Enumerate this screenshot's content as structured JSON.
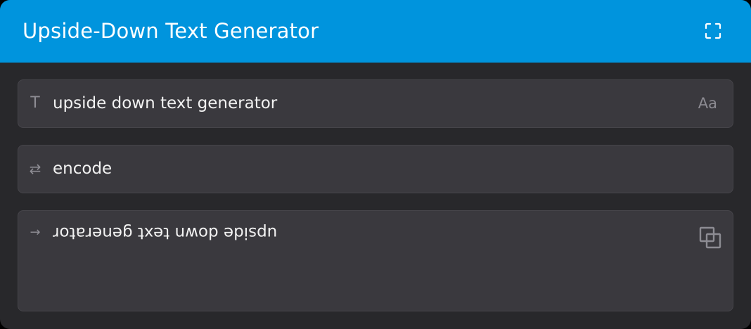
{
  "app": {
    "title": "Upside-Down Text Generator",
    "accent_color": "#0094dd"
  },
  "header": {
    "fullscreen_icon": "fullscreen-icon"
  },
  "input": {
    "icon": "text-t-icon",
    "value": "upside down text generator",
    "case_toggle_label": "Aa"
  },
  "mode": {
    "icon": "swap-arrows-icon",
    "value": "encode"
  },
  "output": {
    "icon": "arrow-right-icon",
    "value": "upside down text generator",
    "copy_icon": "copy-icon"
  }
}
